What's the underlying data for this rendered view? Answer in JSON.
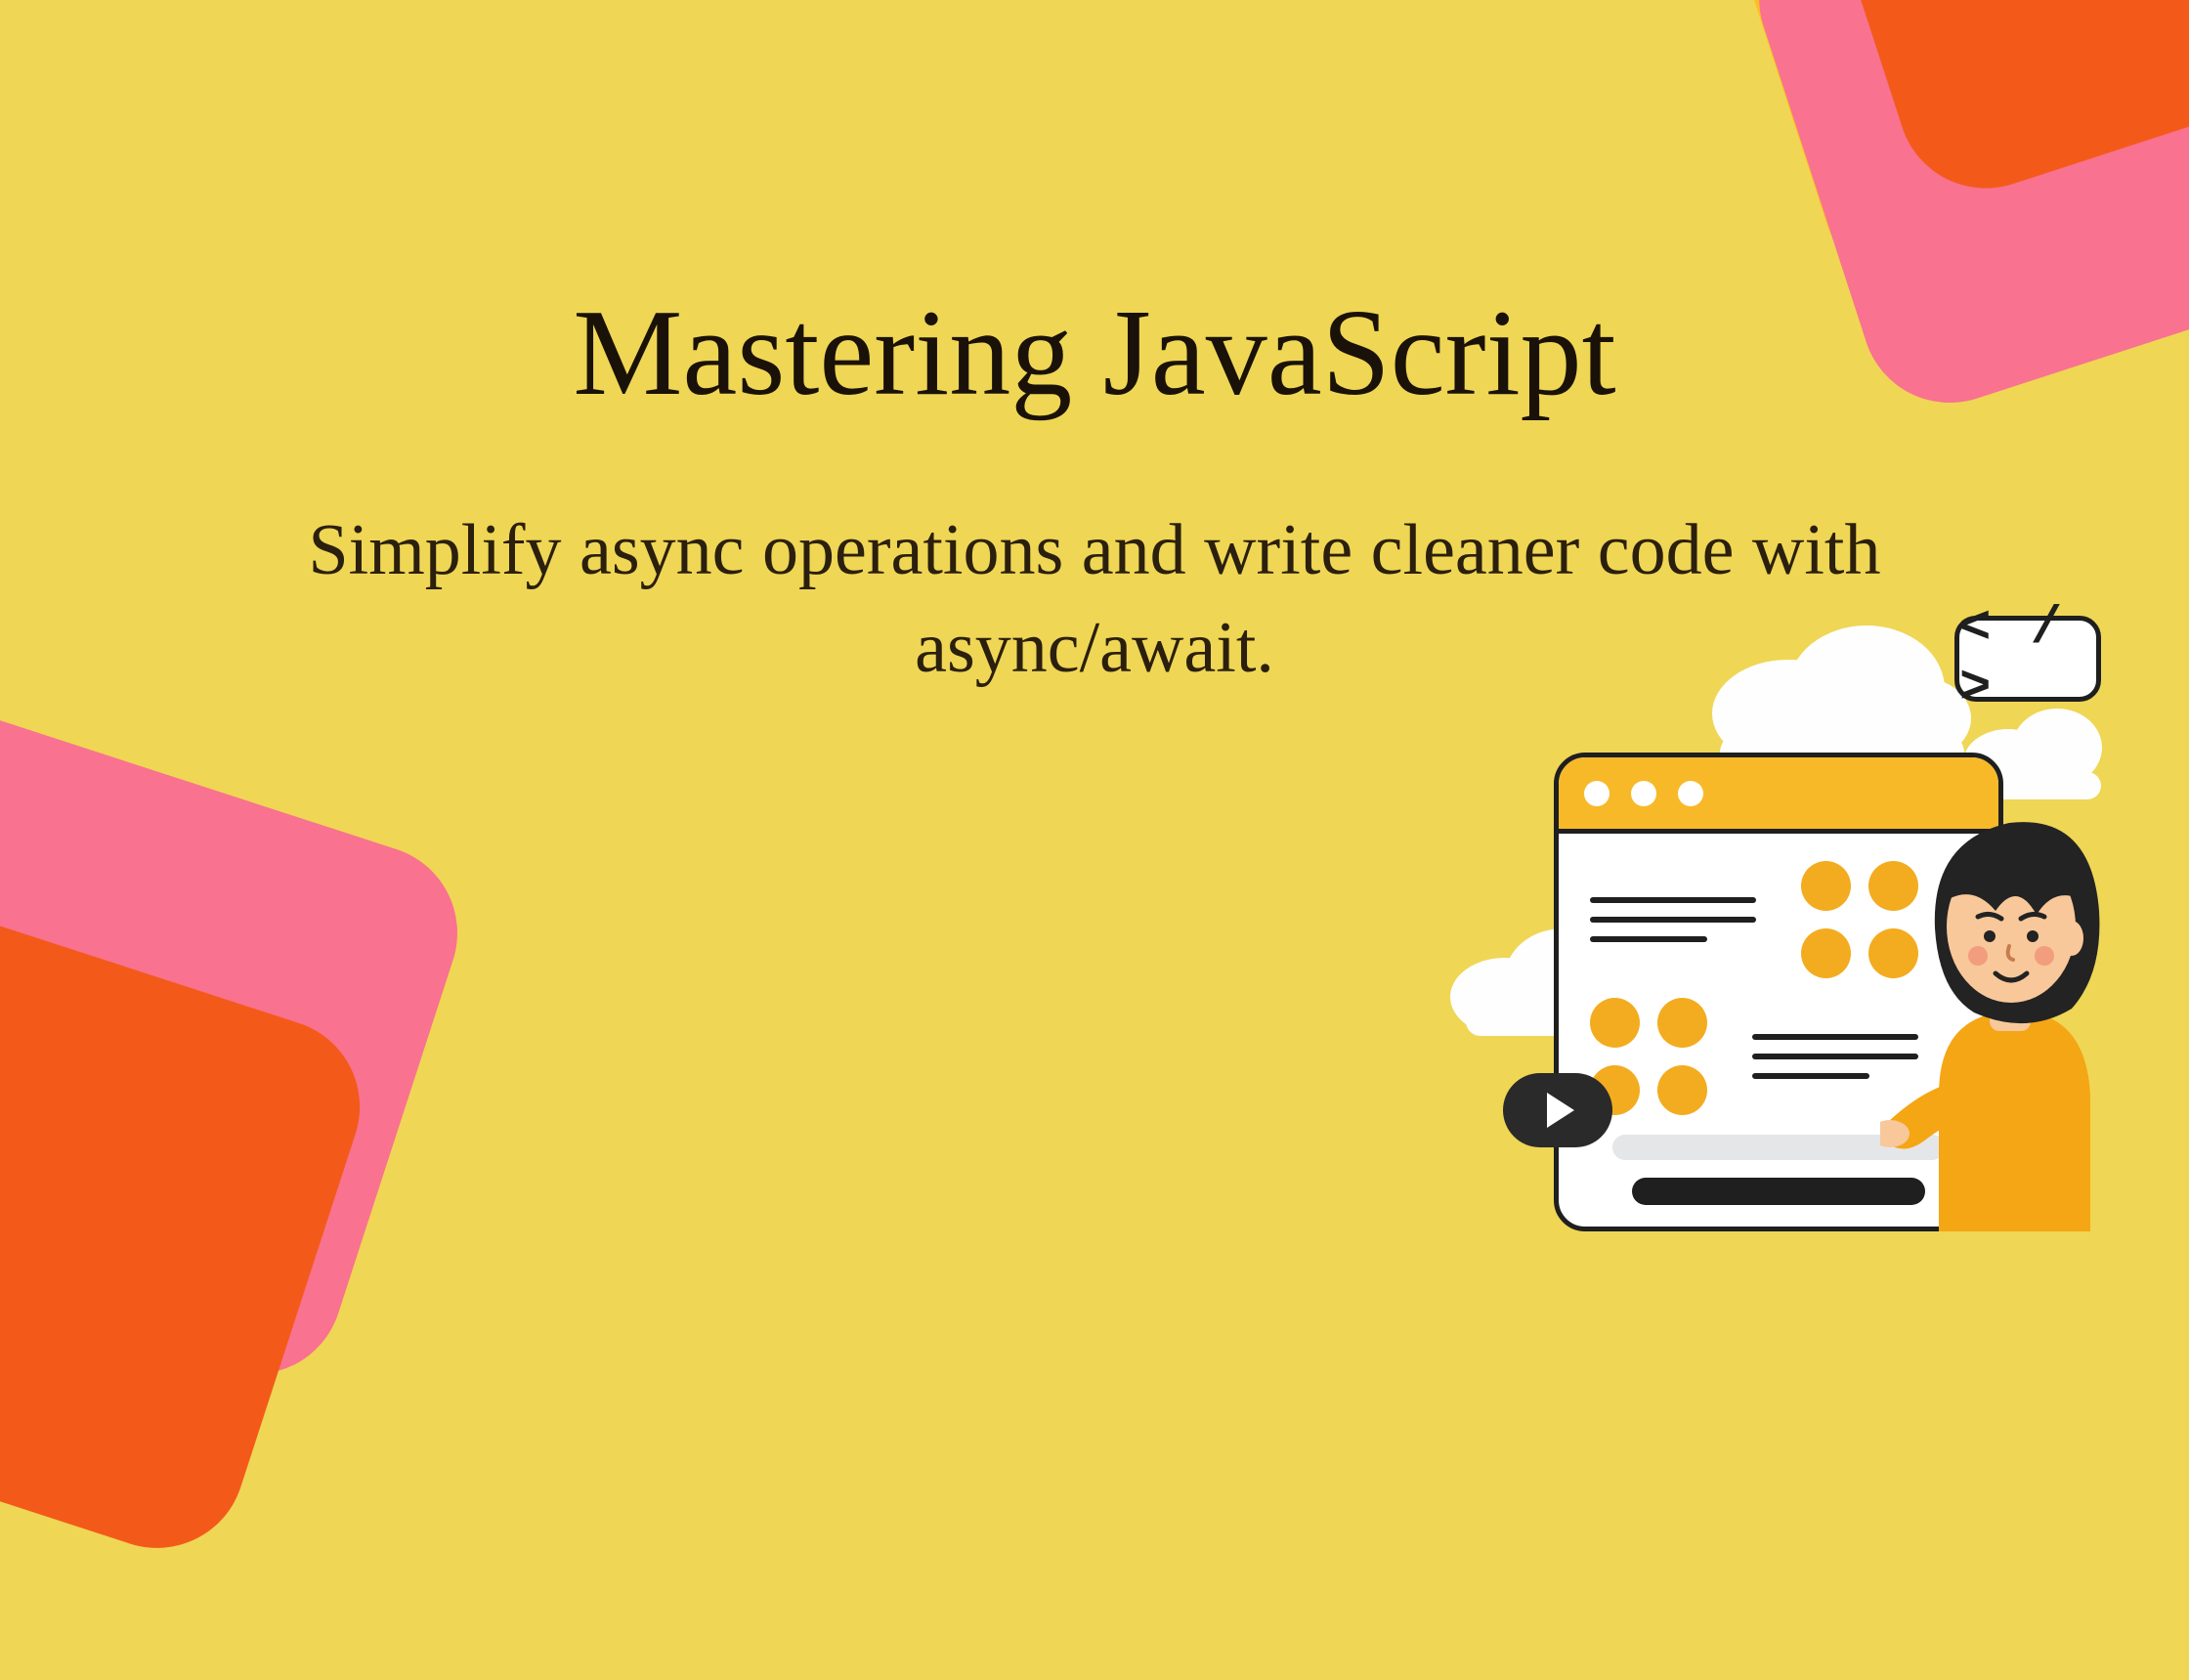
{
  "title": "Mastering JavaScript",
  "subtitle": "Simplify async operations and write cleaner code with async/await.",
  "codetag": "< / >"
}
